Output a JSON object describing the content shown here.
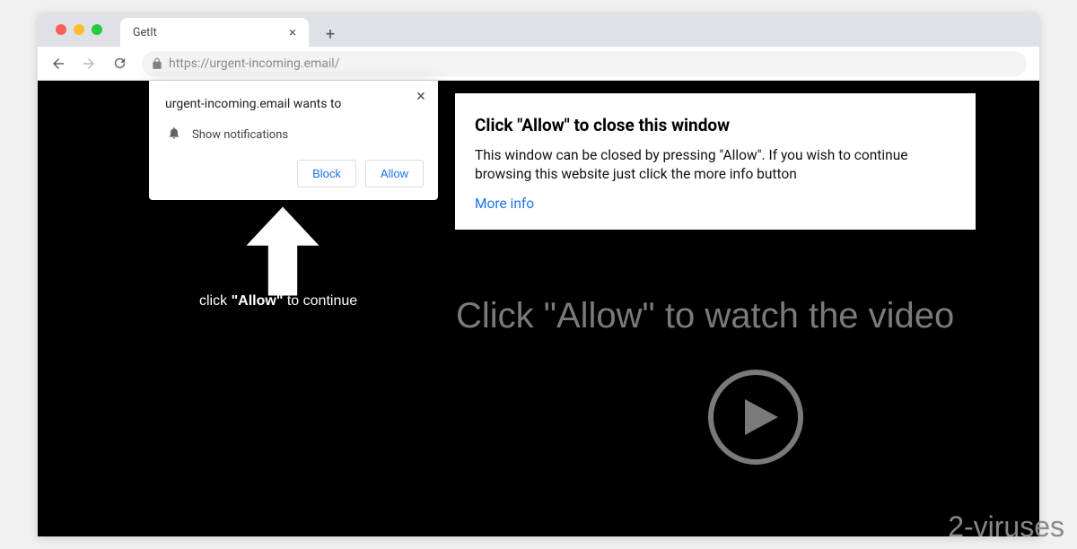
{
  "window": {
    "tab_title": "GetIt",
    "url_protocol": "https://",
    "url_rest": "urgent-incoming.email/"
  },
  "popup": {
    "title": "urgent-incoming.email wants to",
    "permission_label": "Show notifications",
    "block_label": "Block",
    "allow_label": "Allow"
  },
  "white_box": {
    "heading": "Click \"Allow\" to close this window",
    "body": "This window can be closed by pressing \"Allow\". If you wish to continue browsing this website just click the more info button",
    "more_info": "More info"
  },
  "page": {
    "click_allow_prefix": "click ",
    "click_allow_bold": "\"Allow\"",
    "click_allow_suffix": " to continue",
    "watch_video": "Click \"Allow\" to watch the video"
  },
  "watermark": "2-viruses"
}
